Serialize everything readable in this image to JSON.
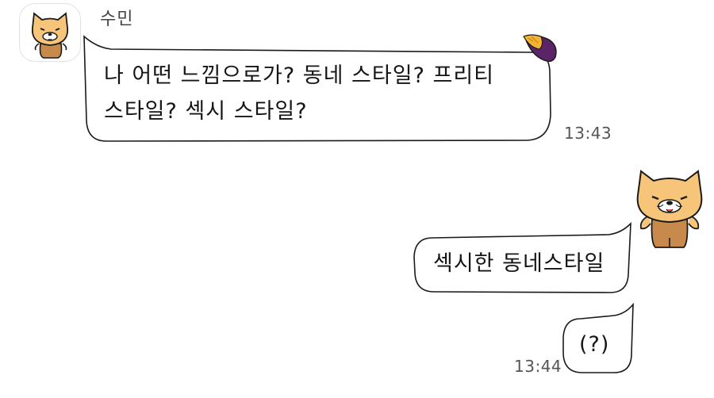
{
  "chat": {
    "sender_name": "수민",
    "messages": [
      {
        "side": "left",
        "lines": [
          "나 어떤 느낌으로가? 동네 스타일? 프리티",
          "스타일? 섹시 스타일?"
        ],
        "time": "13:43"
      },
      {
        "side": "right",
        "lines": [
          "섹시한 동네스타일"
        ]
      },
      {
        "side": "right",
        "lines": [
          "(?)"
        ],
        "time": "13:44"
      }
    ]
  },
  "icons": {
    "incoming_avatar": "cat-avatar-icon",
    "outgoing_avatar": "cat-avatar-icon",
    "bubble_decoration": "sweet-potato-icon"
  },
  "colors": {
    "cat_fur": "#F6C57A",
    "cat_body": "#C88A4C",
    "cat_outline": "#1a1a1a",
    "potato_purple": "#5A2466",
    "potato_flesh": "#F2B233",
    "bubble_fill": "#ffffff",
    "bubble_stroke": "#1a1a1a"
  }
}
